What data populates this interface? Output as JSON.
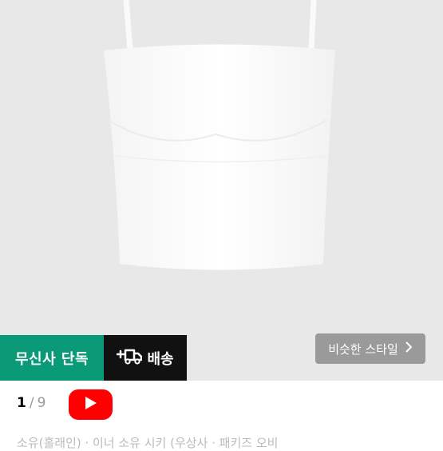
{
  "product": {
    "image_alt": "white tube top with thin straps"
  },
  "badges": {
    "exclusive_label": "무신사 단독",
    "delivery_label": "배송",
    "delivery_icon": "truck-plus-icon"
  },
  "similar_style": {
    "label": "비슷한 스타일",
    "icon": "chevron-right-icon"
  },
  "pager": {
    "current": "1",
    "separator": "/",
    "total": "9"
  },
  "video": {
    "icon": "youtube-play-icon"
  },
  "description": {
    "text": "소유(홀래인) · 이너 소유 시키 (우상사 · 패키즈 오비"
  },
  "colors": {
    "exclusive_bg": "#0a9a78",
    "delivery_bg": "#111111",
    "youtube_red": "#ff0000",
    "hero_bg": "#e8e8e8"
  }
}
